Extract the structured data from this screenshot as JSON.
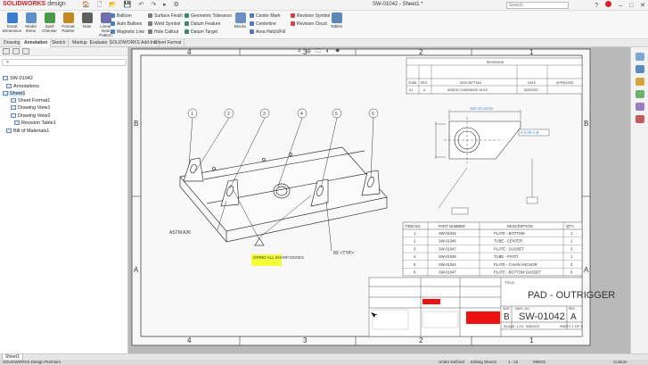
{
  "app": {
    "brand": "SOLIDWORKS",
    "edition": "design",
    "doc_title": "SW-01042 - Sheet1 *",
    "search_placeholder": "Search"
  },
  "ribbon": {
    "big": [
      {
        "label": "Smart Dimension",
        "color": "#3d7bd0"
      },
      {
        "label": "Model Items",
        "color": "#5f8fc9"
      },
      {
        "label": "Spell Checker",
        "color": "#4a9a4a"
      },
      {
        "label": "Format Painter",
        "color": "#c48a22"
      },
      {
        "label": "Note",
        "color": "#5f5f5f"
      },
      {
        "label": "Linear Note Pattern",
        "color": "#6f6fb0"
      }
    ],
    "col1": [
      "Balloon",
      "Auto Balloon",
      "Magnetic Line"
    ],
    "col2": [
      "Surface Finish",
      "Weld Symbol",
      "Hole Callout"
    ],
    "col3": [
      "Geometric Tolerance",
      "Datum Feature",
      "Datum Target"
    ],
    "blocks": "Blocks",
    "col4": [
      "Center Mark",
      "Centerline",
      "Area Hatch/Fill"
    ],
    "col5": [
      "Revision Symbol",
      "Revision Cloud"
    ],
    "tables": "Tables"
  },
  "tabs": [
    "Drawing",
    "Annotation",
    "Sketch",
    "Markup",
    "Evaluate",
    "SOLIDWORKS Add-Ins",
    "Sheet Format"
  ],
  "active_tab": "Annotation",
  "feature_tree": {
    "filter": "",
    "items": [
      {
        "label": "SW-01042"
      },
      {
        "label": "Annotations"
      },
      {
        "label": "Sheet1"
      },
      {
        "label": "Sheet Format1"
      },
      {
        "label": "Drawing View1"
      },
      {
        "label": "Drawing View2"
      },
      {
        "label": "Revision Table1"
      },
      {
        "label": "Bill of Materials1"
      }
    ]
  },
  "drawing": {
    "zone_cols": [
      "4",
      "3",
      "2",
      "1"
    ],
    "zone_rows": [
      "B",
      "A"
    ],
    "revisions": {
      "title": "REVISIONS",
      "headers": [
        "ZONE",
        "REV.",
        "DESCRIPTION",
        "DATE",
        "APPROVED"
      ],
      "row": [
        "A1",
        "A",
        "ADDED CLEARANCE HOLE",
        "8/25/2023",
        ""
      ]
    },
    "balloons": [
      "1",
      "2",
      "3",
      "4",
      "5",
      "6"
    ],
    "notes": {
      "material": "ASTM A36",
      "grind": "GRIND ALL SHARP EDGES",
      "view_label": "8X <TYP>"
    },
    "detail_dims": {
      "width": "163.10 ±0.01",
      "gtol": "⌖ 0.05 A B"
    },
    "bom": {
      "headers": [
        "ITEM NO.",
        "PART NUMBER",
        "DESCRIPTION",
        "QTY."
      ],
      "rows": [
        [
          "1",
          "SW-01045",
          "PLATE - BOTTOM",
          "1"
        ],
        [
          "2",
          "SW-01046",
          "TUBE - CENTER",
          "1"
        ],
        [
          "3",
          "SW-01047",
          "PLATE - GUSSET",
          "2"
        ],
        [
          "4",
          "SW-01048",
          "TUBE - PIVOT",
          "1"
        ],
        [
          "5",
          "SW-01044",
          "PLATE - CHAIN ANCHOR",
          "2"
        ],
        [
          "6",
          "SW-01047",
          "PLATE - BOTTOM GUSSET",
          "6"
        ]
      ]
    },
    "title_block": {
      "title_label": "TITLE:",
      "title": "PAD - OUTRIGGER",
      "size_label": "SIZE",
      "dwg_label": "DWG. NO.",
      "rev_label": "REV",
      "size": "B",
      "dwg_no": "SW-01042",
      "rev": "A",
      "scale": "SCALE: 1:10",
      "weight": "WEIGHT:",
      "sheet": "SHEET 1 OF 1"
    }
  },
  "sheet_tab": "Sheet1",
  "status": {
    "left": "SOLIDWORKS Design Premium",
    "constraint": "Under Defined",
    "mode": "Editing Sheet1",
    "scale": "1 : 10",
    "units": "MMGS",
    "custom": "Custom"
  }
}
